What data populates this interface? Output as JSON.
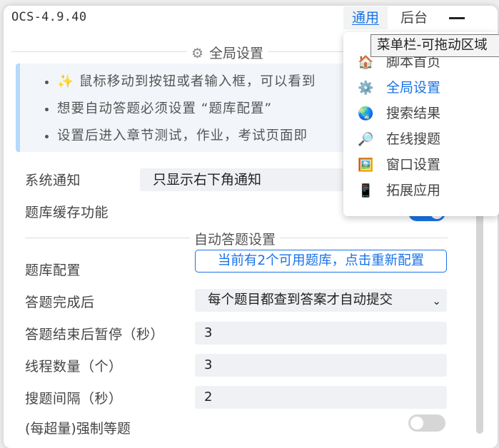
{
  "header": {
    "title": "OCS-4.9.40",
    "tabs": [
      {
        "label": "通用",
        "active": true
      },
      {
        "label": "后台",
        "active": false
      }
    ]
  },
  "global_settings": {
    "title": "全局设置",
    "tips": [
      "✨ 鼠标移动到按钮或者输入框，可以看到",
      "想要自动答题必须设置 “题库配置”",
      "设置后进入章节测试，作业，考试页面即"
    ],
    "notice_label": "系统通知",
    "notice_value": "只显示右下角通知",
    "cache_label": "题库缓存功能",
    "cache_enabled": true
  },
  "auto_answer": {
    "title": "自动答题设置",
    "bank_label": "题库配置",
    "bank_button": "当前有2个可用题库，点击重新配置",
    "after_label": "答题完成后",
    "after_value": "每个题目都查到答案才自动提交",
    "pause_label": "答题结束后暂停（秒）",
    "pause_value": "3",
    "threads_label": "线程数量（个）",
    "threads_value": "3",
    "interval_label": "搜题间隔（秒）",
    "interval_value": "2",
    "force_label": "(每超量)强制等题",
    "force_enabled": false
  },
  "menu": {
    "tooltip": "菜单栏-可拖动区域",
    "items": [
      {
        "icon": "🏠",
        "label": "脚本首页"
      },
      {
        "icon": "⚙️",
        "label": "全局设置",
        "active": true
      },
      {
        "icon": "🌏",
        "label": "搜索结果"
      },
      {
        "icon": "🔎",
        "label": "在线搜题"
      },
      {
        "icon": "🖼️",
        "label": "窗口设置"
      },
      {
        "icon": "📱",
        "label": "拓展应用"
      }
    ]
  },
  "colors": {
    "accent": "#1a73e8",
    "tip_border": "#b5dafb"
  }
}
